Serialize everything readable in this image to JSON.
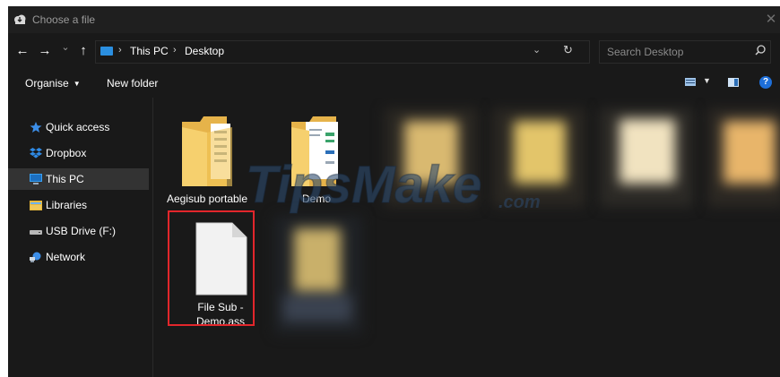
{
  "window": {
    "title": "Choose a file",
    "close_glyph": "✕"
  },
  "nav": {
    "back_glyph": "←",
    "forward_glyph": "→",
    "recent_glyph": "⌄",
    "up_glyph": "↑",
    "crumb_sep": "›",
    "breadcrumbs": [
      "This PC",
      "Desktop"
    ],
    "dropdown_glyph": "⌄",
    "refresh_glyph": "↻",
    "search_placeholder": "Search Desktop"
  },
  "toolbar": {
    "organise_label": "Organise",
    "new_folder_label": "New folder",
    "help_glyph": "?"
  },
  "sidebar": {
    "items": [
      {
        "label": "Quick access",
        "icon": "star-icon"
      },
      {
        "label": "Dropbox",
        "icon": "dropbox-icon"
      },
      {
        "label": "This PC",
        "icon": "pc-icon",
        "selected": true
      },
      {
        "label": "Libraries",
        "icon": "libraries-icon"
      },
      {
        "label": "USB Drive (F:)",
        "icon": "usb-drive-icon"
      },
      {
        "label": "Network",
        "icon": "network-icon"
      }
    ]
  },
  "files": [
    {
      "name": "Aegisub portable",
      "type": "folder"
    },
    {
      "name": "Demo",
      "type": "folder"
    },
    {
      "name": "File Sub - Demo.ass",
      "name_line1": "File Sub -",
      "name_line2": "Demo.ass",
      "type": "file",
      "highlighted": true
    }
  ],
  "watermark": {
    "text": "TipsMake",
    "suffix": ".com"
  },
  "colors": {
    "background": "#191919",
    "selected": "#333333",
    "accent": "#1e6fd9",
    "highlight_border": "#e2262b",
    "folder": "#f3c85a"
  }
}
